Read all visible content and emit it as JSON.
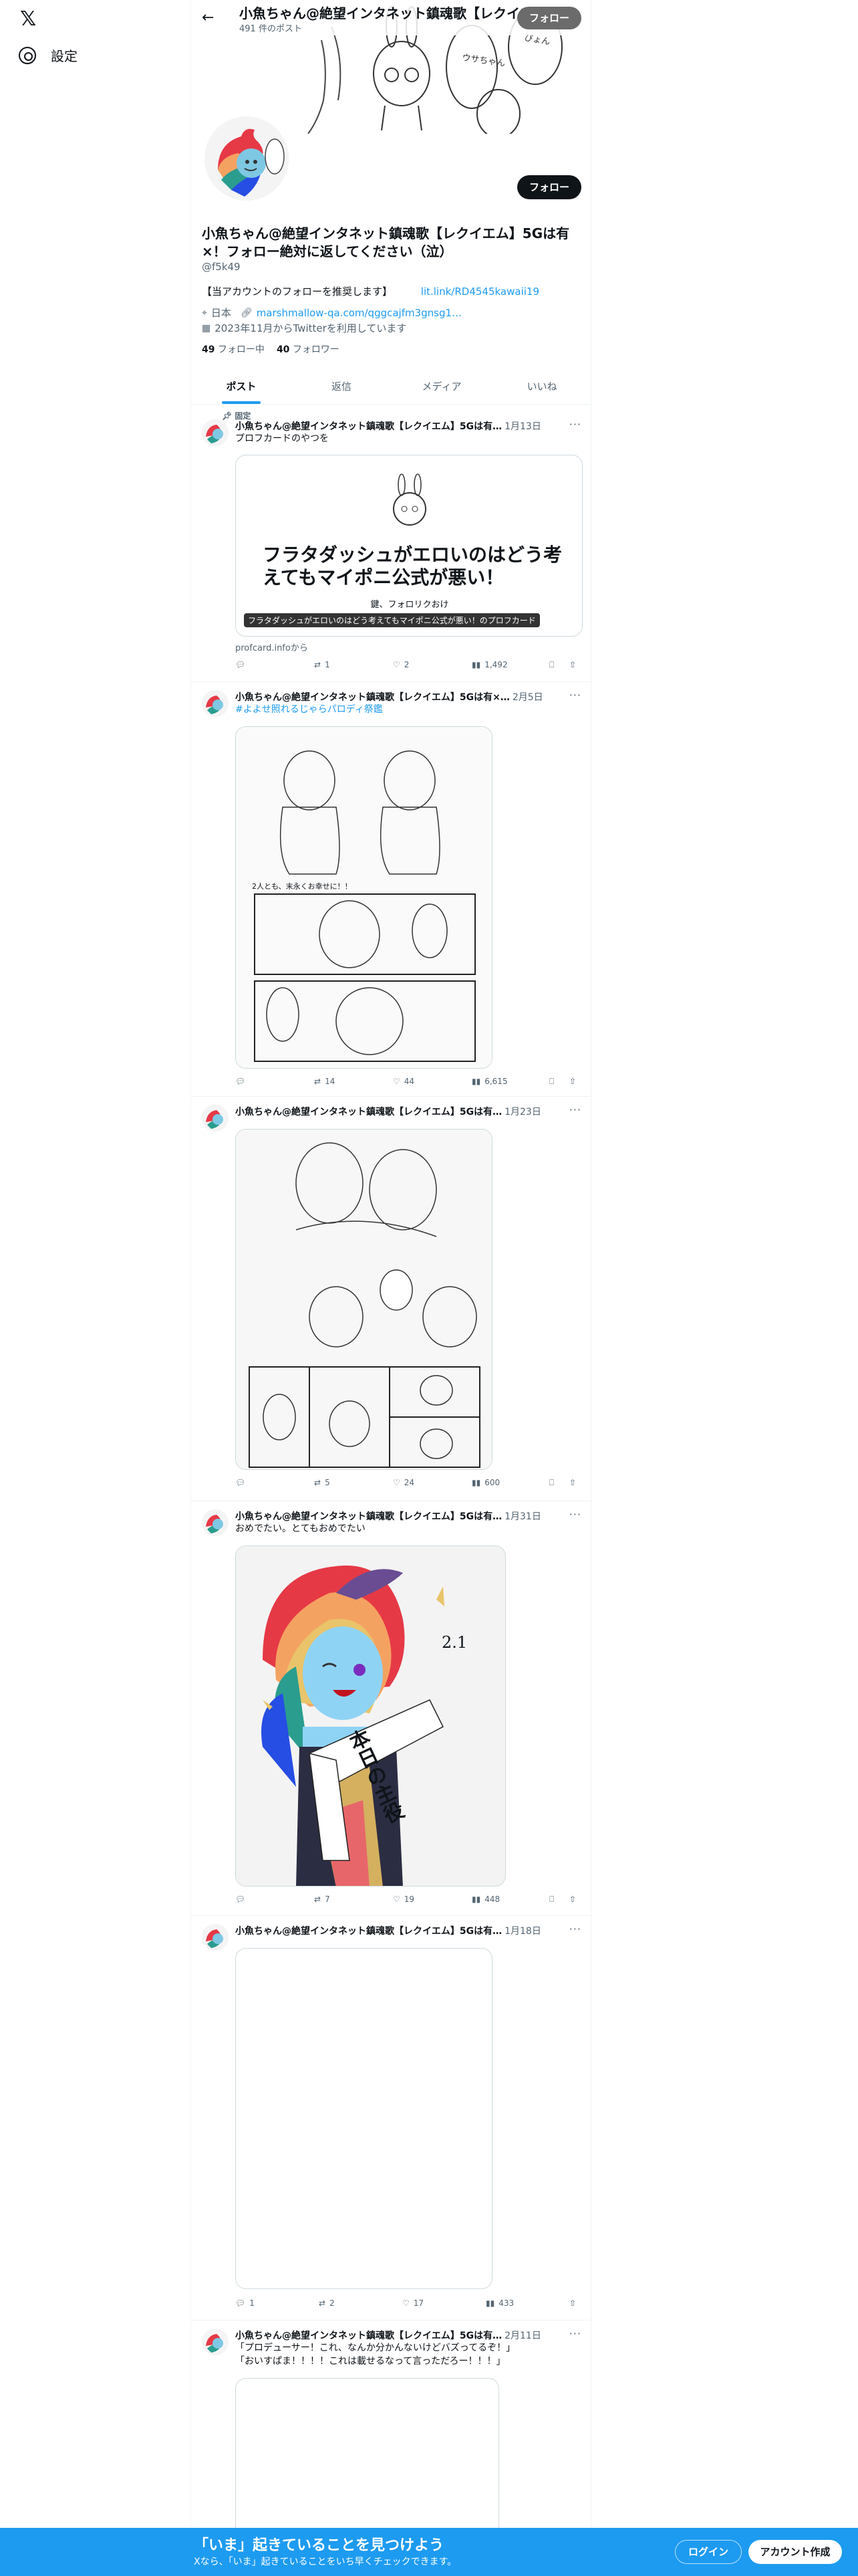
{
  "nav": {
    "settings_label": "設定"
  },
  "header": {
    "display_name": "小魚ちゃん@絶望インタネット鎮魂歌【レクイエム】5G…",
    "post_count": "491 件のポスト",
    "follow_label": "フォロー"
  },
  "profile": {
    "name": "小魚ちゃん@絶望インタネット鎮魂歌【レクイエム】5Gは有×！フォロー絶対に返してください（泣）",
    "handle": "@f5k49",
    "bio": "【当アカウントのフォローを推奨します】",
    "bio_link": "lit.link/RD4545kawaii19",
    "location": "日本",
    "website": "marshmallow-qa.com/qggcajfm3gnsg1…",
    "joined": "2023年11月からTwitterを利用しています",
    "following_count": "49",
    "following_label": "フォロー中",
    "followers_count": "40",
    "followers_label": "フォロワー",
    "follow_label": "フォロー"
  },
  "tabs": [
    "ポスト",
    "返信",
    "メディア",
    "いいね"
  ],
  "pinned_label": "固定",
  "tweets": [
    {
      "name": "小魚ちゃん@絶望インタネット鎮魂歌【レクイエム】5Gは有…",
      "date": "1月13日",
      "text": "プロフカードのやつを",
      "card_title": "フラタダッシュがエロいのはどう考えてもマイポニ公式が悪い！",
      "card_sub": "鍵、フォロリクおけ",
      "card_label": "フラタダッシュがエロいのはどう考えてもマイポニ公式が悪い！のプロフカード",
      "card_source": "profcard.infoから",
      "reply": "",
      "retweet": "1",
      "like": "2",
      "views": "1,492"
    },
    {
      "name": "小魚ちゃん@絶望インタネット鎮魂歌【レクイエム】5Gは有×…",
      "date": "2月5日",
      "text": "#よよせ照れるじゃらパロディ祭鑑",
      "caption": "2人とも、末永くお幸せに！！",
      "reply": "",
      "retweet": "14",
      "like": "44",
      "views": "6,615"
    },
    {
      "name": "小魚ちゃん@絶望インタネット鎮魂歌【レクイエム】5Gは有…",
      "date": "1月23日",
      "text": "",
      "reply": "",
      "retweet": "5",
      "like": "24",
      "views": "600"
    },
    {
      "name": "小魚ちゃん@絶望インタネット鎮魂歌【レクイエム】5Gは有…",
      "date": "1月31日",
      "text": "おめでたい。とてもおめでたい",
      "image_text": "本日の主役",
      "image_date": "2.1",
      "reply": "",
      "retweet": "7",
      "like": "19",
      "views": "448"
    },
    {
      "name": "小魚ちゃん@絶望インタネット鎮魂歌【レクイエム】5Gは有…",
      "date": "1月18日",
      "text": "",
      "reply": "1",
      "retweet": "2",
      "like": "17",
      "views": "433"
    },
    {
      "name": "小魚ちゃん@絶望インタネット鎮魂歌【レクイエム】5Gは有…",
      "date": "2月11日",
      "text": "「プロデューサー！これ、なんか分かんないけどバズってるぞ！」",
      "text2": "「おいすぱま！！！！これは載せるなって言っただろー！！！」"
    }
  ],
  "bottom": {
    "title": "「いま」起きていることを見つけよう",
    "subtitle": "Xなら、「いま」起きていることをいち早くチェックできます。",
    "login": "ログイン",
    "signup": "アカウント作成"
  }
}
